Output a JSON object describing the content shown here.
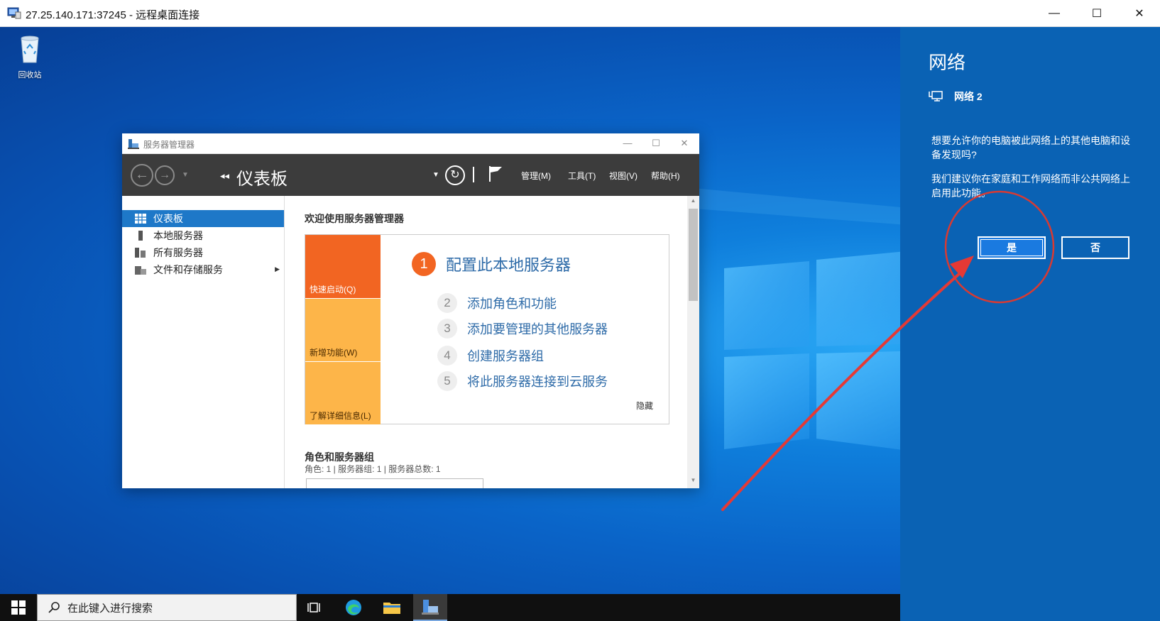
{
  "rdp": {
    "title": "27.25.140.171:37245 - 远程桌面连接",
    "minimize": "—",
    "maximize": "☐",
    "close": "✕"
  },
  "desktop": {
    "recycle_bin_label": "回收站"
  },
  "server_manager": {
    "window_title": "服务器管理器",
    "page_title": "仪表板",
    "menus": [
      "管理(M)",
      "工具(T)",
      "视图(V)",
      "帮助(H)"
    ],
    "sidebar": [
      {
        "label": "仪表板",
        "icon": "dashboard-icon",
        "active": true
      },
      {
        "label": "本地服务器",
        "icon": "local-server-icon",
        "active": false
      },
      {
        "label": "所有服务器",
        "icon": "all-servers-icon",
        "active": false
      },
      {
        "label": "文件和存储服务",
        "icon": "file-storage-icon",
        "active": false,
        "has_arrow": true
      }
    ],
    "welcome_title": "欢迎使用服务器管理器",
    "tiles": [
      "快速启动(Q)",
      "新增功能(W)",
      "了解详细信息(L)"
    ],
    "main_step": {
      "num": "1",
      "text": "配置此本地服务器"
    },
    "steps": [
      {
        "num": "2",
        "text": "添加角色和功能"
      },
      {
        "num": "3",
        "text": "添加要管理的其他服务器"
      },
      {
        "num": "4",
        "text": "创建服务器组"
      },
      {
        "num": "5",
        "text": "将此服务器连接到云服务"
      }
    ],
    "hide_label": "隐藏",
    "roles_title": "角色和服务器组",
    "roles_sub": "角色: 1 | 服务器组: 1 | 服务器总数: 1"
  },
  "network_flyout": {
    "title": "网络",
    "network_name": "网络 2",
    "question": "想要允许你的电脑被此网络上的其他电脑和设备发现吗?",
    "recommendation": "我们建议你在家庭和工作网络而非公共网络上启用此功能。",
    "yes_label": "是",
    "no_label": "否"
  },
  "taskbar": {
    "search_placeholder": "在此键入进行搜索"
  },
  "colors": {
    "accent_blue": "#1e78c8",
    "flyout_bg": "#0a62b4",
    "tile_orange": "#f26522",
    "tile_amber": "#fdb549",
    "annotation_red": "#e53935"
  }
}
